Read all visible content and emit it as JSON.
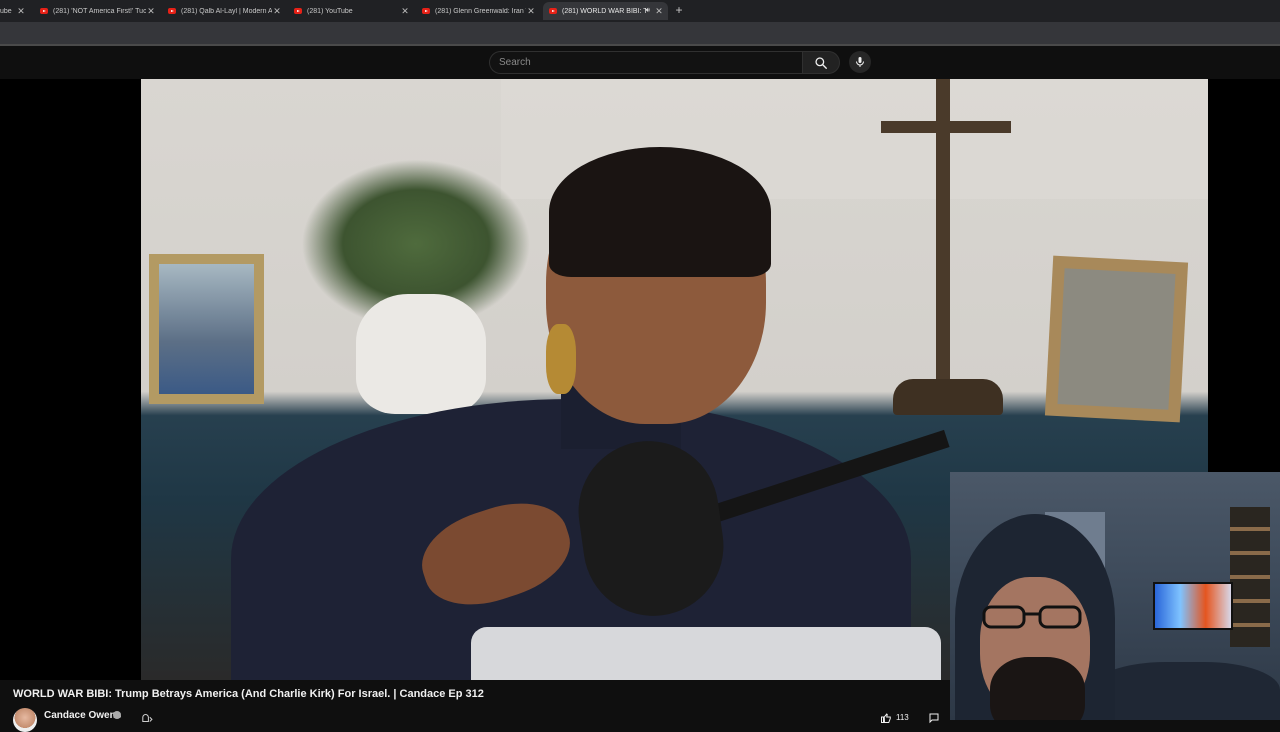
{
  "browser": {
    "tabs": [
      {
        "title": "ube",
        "active": false
      },
      {
        "title": "(281) 'NOT America First!' Tucke",
        "active": false
      },
      {
        "title": "(281) Qalb Al-Layl | Modern Ar",
        "active": false
      },
      {
        "title": "(281) YouTube",
        "active": false
      },
      {
        "title": "(281) Glenn Greenwald: Iran W",
        "active": false
      },
      {
        "title": "(281) WORLD WAR BIBI: Tru",
        "active": true
      }
    ],
    "new_tab_label": "+"
  },
  "masthead": {
    "search_placeholder": "Search"
  },
  "video": {
    "title": "WORLD WAR BIBI: Trump Betrays America (And Charlie Kirk) For Israel. | Candace Ep 312",
    "channel": "Candace Owens",
    "like_count": "113"
  },
  "icons": {
    "favicon": "youtube-favicon",
    "search": "search-icon",
    "mic": "mic-icon",
    "close": "close-icon",
    "audio": "speaker-icon",
    "like": "thumbs-up-icon",
    "share": "share-icon"
  },
  "colors": {
    "youtube_red": "#e62117",
    "background": "#0f0f0f"
  }
}
